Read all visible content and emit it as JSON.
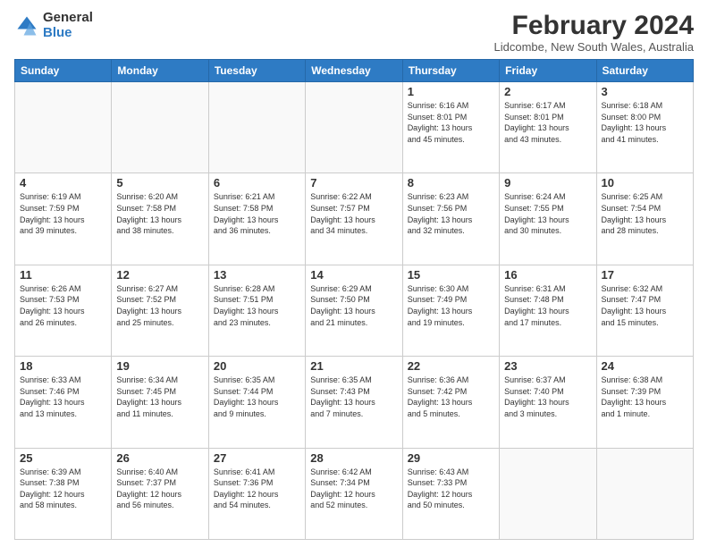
{
  "logo": {
    "general": "General",
    "blue": "Blue"
  },
  "header": {
    "title": "February 2024",
    "subtitle": "Lidcombe, New South Wales, Australia"
  },
  "columns": [
    "Sunday",
    "Monday",
    "Tuesday",
    "Wednesday",
    "Thursday",
    "Friday",
    "Saturday"
  ],
  "weeks": [
    [
      {
        "day": "",
        "info": ""
      },
      {
        "day": "",
        "info": ""
      },
      {
        "day": "",
        "info": ""
      },
      {
        "day": "",
        "info": ""
      },
      {
        "day": "1",
        "info": "Sunrise: 6:16 AM\nSunset: 8:01 PM\nDaylight: 13 hours\nand 45 minutes."
      },
      {
        "day": "2",
        "info": "Sunrise: 6:17 AM\nSunset: 8:01 PM\nDaylight: 13 hours\nand 43 minutes."
      },
      {
        "day": "3",
        "info": "Sunrise: 6:18 AM\nSunset: 8:00 PM\nDaylight: 13 hours\nand 41 minutes."
      }
    ],
    [
      {
        "day": "4",
        "info": "Sunrise: 6:19 AM\nSunset: 7:59 PM\nDaylight: 13 hours\nand 39 minutes."
      },
      {
        "day": "5",
        "info": "Sunrise: 6:20 AM\nSunset: 7:58 PM\nDaylight: 13 hours\nand 38 minutes."
      },
      {
        "day": "6",
        "info": "Sunrise: 6:21 AM\nSunset: 7:58 PM\nDaylight: 13 hours\nand 36 minutes."
      },
      {
        "day": "7",
        "info": "Sunrise: 6:22 AM\nSunset: 7:57 PM\nDaylight: 13 hours\nand 34 minutes."
      },
      {
        "day": "8",
        "info": "Sunrise: 6:23 AM\nSunset: 7:56 PM\nDaylight: 13 hours\nand 32 minutes."
      },
      {
        "day": "9",
        "info": "Sunrise: 6:24 AM\nSunset: 7:55 PM\nDaylight: 13 hours\nand 30 minutes."
      },
      {
        "day": "10",
        "info": "Sunrise: 6:25 AM\nSunset: 7:54 PM\nDaylight: 13 hours\nand 28 minutes."
      }
    ],
    [
      {
        "day": "11",
        "info": "Sunrise: 6:26 AM\nSunset: 7:53 PM\nDaylight: 13 hours\nand 26 minutes."
      },
      {
        "day": "12",
        "info": "Sunrise: 6:27 AM\nSunset: 7:52 PM\nDaylight: 13 hours\nand 25 minutes."
      },
      {
        "day": "13",
        "info": "Sunrise: 6:28 AM\nSunset: 7:51 PM\nDaylight: 13 hours\nand 23 minutes."
      },
      {
        "day": "14",
        "info": "Sunrise: 6:29 AM\nSunset: 7:50 PM\nDaylight: 13 hours\nand 21 minutes."
      },
      {
        "day": "15",
        "info": "Sunrise: 6:30 AM\nSunset: 7:49 PM\nDaylight: 13 hours\nand 19 minutes."
      },
      {
        "day": "16",
        "info": "Sunrise: 6:31 AM\nSunset: 7:48 PM\nDaylight: 13 hours\nand 17 minutes."
      },
      {
        "day": "17",
        "info": "Sunrise: 6:32 AM\nSunset: 7:47 PM\nDaylight: 13 hours\nand 15 minutes."
      }
    ],
    [
      {
        "day": "18",
        "info": "Sunrise: 6:33 AM\nSunset: 7:46 PM\nDaylight: 13 hours\nand 13 minutes."
      },
      {
        "day": "19",
        "info": "Sunrise: 6:34 AM\nSunset: 7:45 PM\nDaylight: 13 hours\nand 11 minutes."
      },
      {
        "day": "20",
        "info": "Sunrise: 6:35 AM\nSunset: 7:44 PM\nDaylight: 13 hours\nand 9 minutes."
      },
      {
        "day": "21",
        "info": "Sunrise: 6:35 AM\nSunset: 7:43 PM\nDaylight: 13 hours\nand 7 minutes."
      },
      {
        "day": "22",
        "info": "Sunrise: 6:36 AM\nSunset: 7:42 PM\nDaylight: 13 hours\nand 5 minutes."
      },
      {
        "day": "23",
        "info": "Sunrise: 6:37 AM\nSunset: 7:40 PM\nDaylight: 13 hours\nand 3 minutes."
      },
      {
        "day": "24",
        "info": "Sunrise: 6:38 AM\nSunset: 7:39 PM\nDaylight: 13 hours\nand 1 minute."
      }
    ],
    [
      {
        "day": "25",
        "info": "Sunrise: 6:39 AM\nSunset: 7:38 PM\nDaylight: 12 hours\nand 58 minutes."
      },
      {
        "day": "26",
        "info": "Sunrise: 6:40 AM\nSunset: 7:37 PM\nDaylight: 12 hours\nand 56 minutes."
      },
      {
        "day": "27",
        "info": "Sunrise: 6:41 AM\nSunset: 7:36 PM\nDaylight: 12 hours\nand 54 minutes."
      },
      {
        "day": "28",
        "info": "Sunrise: 6:42 AM\nSunset: 7:34 PM\nDaylight: 12 hours\nand 52 minutes."
      },
      {
        "day": "29",
        "info": "Sunrise: 6:43 AM\nSunset: 7:33 PM\nDaylight: 12 hours\nand 50 minutes."
      },
      {
        "day": "",
        "info": ""
      },
      {
        "day": "",
        "info": ""
      }
    ]
  ]
}
